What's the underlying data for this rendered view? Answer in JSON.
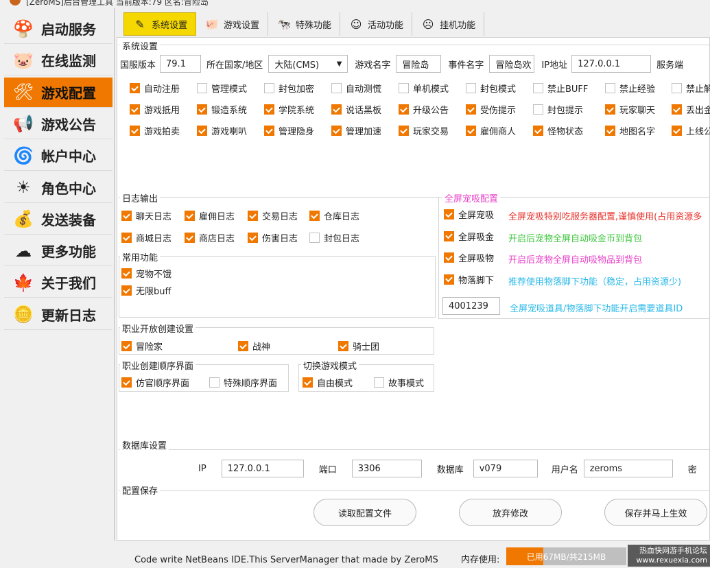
{
  "window": {
    "title": "[ZeroMS]后台管理工具 当前版本:79 区名:冒险岛"
  },
  "sidebar": {
    "items": [
      {
        "label": "启动服务",
        "icon": "mushroom-icon"
      },
      {
        "label": "在线监测",
        "icon": "monitor-icon"
      },
      {
        "label": "游戏配置",
        "icon": "tools-icon",
        "active": true
      },
      {
        "label": "游戏公告",
        "icon": "megaphone-icon"
      },
      {
        "label": "帐户中心",
        "icon": "pinwheel-icon"
      },
      {
        "label": "角色中心",
        "icon": "sun-icon"
      },
      {
        "label": "发送装备",
        "icon": "bag-icon"
      },
      {
        "label": "更多功能",
        "icon": "cloud-icon"
      },
      {
        "label": "关于我们",
        "icon": "maple-leaf-icon"
      },
      {
        "label": "更新日志",
        "icon": "coin-icon"
      }
    ]
  },
  "tabs": [
    {
      "label": "系统设置",
      "icon": "pencil-icon",
      "active": true
    },
    {
      "label": "游戏设置",
      "icon": "pig-icon"
    },
    {
      "label": "特殊功能",
      "icon": "cow-icon"
    },
    {
      "label": "活动功能",
      "icon": "face-icon"
    },
    {
      "label": "挂机功能",
      "icon": "sleep-face-icon"
    }
  ],
  "system": {
    "title": "系统设置",
    "version_label": "国服版本",
    "version_value": "79.1",
    "region_label": "所在国家/地区",
    "region_value": "大陆(CMS)",
    "game_name_label": "游戏名字",
    "game_name_value": "冒险岛",
    "event_name_label": "事件名字",
    "event_name_value": "冒险岛欢",
    "ip_label": "IP地址",
    "ip_value": "127.0.0.1",
    "server_label": "服务端",
    "checkbox_rows": [
      [
        {
          "label": "自动注册",
          "checked": true
        },
        {
          "label": "管理模式",
          "checked": false
        },
        {
          "label": "封包加密",
          "checked": false
        },
        {
          "label": "自动测慌",
          "checked": false
        },
        {
          "label": "单机模式",
          "checked": false
        },
        {
          "label": "封包模式",
          "checked": false
        },
        {
          "label": "禁止BUFF",
          "checked": false
        },
        {
          "label": "禁止经验",
          "checked": false
        },
        {
          "label": "禁止解",
          "checked": false
        }
      ],
      [
        {
          "label": "游戏抵用",
          "checked": true
        },
        {
          "label": "锻造系统",
          "checked": true
        },
        {
          "label": "学院系统",
          "checked": true
        },
        {
          "label": "说话黑板",
          "checked": true
        },
        {
          "label": "升级公告",
          "checked": true
        },
        {
          "label": "受伤提示",
          "checked": true
        },
        {
          "label": "封包提示",
          "checked": false
        },
        {
          "label": "玩家聊天",
          "checked": true
        },
        {
          "label": "丢出金",
          "checked": true
        }
      ],
      [
        {
          "label": "游戏拍卖",
          "checked": true
        },
        {
          "label": "游戏喇叭",
          "checked": true
        },
        {
          "label": "管理隐身",
          "checked": true
        },
        {
          "label": "管理加速",
          "checked": true
        },
        {
          "label": "玩家交易",
          "checked": true
        },
        {
          "label": "雇佣商人",
          "checked": true
        },
        {
          "label": "怪物状态",
          "checked": true
        },
        {
          "label": "地图名字",
          "checked": true
        },
        {
          "label": "上线公",
          "checked": true
        }
      ]
    ]
  },
  "log": {
    "title": "日志输出",
    "items": [
      {
        "label": "聊天日志",
        "checked": true
      },
      {
        "label": "雇佣日志",
        "checked": true
      },
      {
        "label": "交易日志",
        "checked": true
      },
      {
        "label": "仓库日志",
        "checked": true
      },
      {
        "label": "商城日志",
        "checked": true
      },
      {
        "label": "商店日志",
        "checked": true
      },
      {
        "label": "伤害日志",
        "checked": true
      },
      {
        "label": "封包日志",
        "checked": false
      }
    ]
  },
  "common": {
    "title": "常用功能",
    "items": [
      {
        "label": "宠物不饿",
        "checked": true
      },
      {
        "label": "无限buff",
        "checked": true
      }
    ]
  },
  "pet": {
    "title": "全屏宠吸配置",
    "items": [
      {
        "label": "全屏宠吸",
        "checked": true,
        "desc": "全屏宠吸特别吃服务器配置,谨慎使用(占用资源多",
        "desc_color": "#e8322b"
      },
      {
        "label": "全屏吸金",
        "checked": true,
        "desc": "开启后宠物全屏自动吸金币到背包",
        "desc_color": "#3cc43c"
      },
      {
        "label": "全屏吸物",
        "checked": true,
        "desc": "开启后宠物全屏自动吸物品到背包",
        "desc_color": "#e840c8"
      },
      {
        "label": "物落脚下",
        "checked": true,
        "desc": "推荐使用物落脚下功能（稳定，占用资源少)",
        "desc_color": "#2ab8e8"
      }
    ],
    "item_id": "4001239",
    "item_desc": "全屏宠吸道具/物落脚下功能开启需要道具ID",
    "item_desc_color": "#2ab8e8"
  },
  "job_open": {
    "title": "职业开放创建设置",
    "items": [
      {
        "label": "冒险家",
        "checked": true
      },
      {
        "label": "战神",
        "checked": true
      },
      {
        "label": "骑士团",
        "checked": true
      }
    ]
  },
  "job_order": {
    "title": "职业创建顺序界面",
    "items": [
      {
        "label": "仿官顺序界面",
        "checked": true
      },
      {
        "label": "特殊顺序界面",
        "checked": false
      }
    ]
  },
  "mode": {
    "title": "切换游戏模式",
    "items": [
      {
        "label": "自由模式",
        "checked": true
      },
      {
        "label": "故事模式",
        "checked": false
      }
    ]
  },
  "db": {
    "title": "数据库设置",
    "ip_label": "IP",
    "ip_value": "127.0.0.1",
    "port_label": "端口",
    "port_value": "3306",
    "db_label": "数据库",
    "db_value": "v079",
    "user_label": "用户名",
    "user_value": "zeroms",
    "pwd_label": "密"
  },
  "save": {
    "title": "配置保存",
    "buttons": [
      "读取配置文件",
      "放弃修改",
      "保存并马上生效"
    ]
  },
  "status": {
    "footer": "Code write NetBeans IDE.This ServerManager that made by ZeroMS",
    "mem_label": "内存使用:",
    "mem_text": "已用67MB/共215MB",
    "mem_used_fraction": 0.31,
    "watermark": "热血快网游手机论坛\nwww.rexuexia.com"
  },
  "colors": {
    "accent": "#f07800",
    "tab_active": "#f5d800"
  }
}
